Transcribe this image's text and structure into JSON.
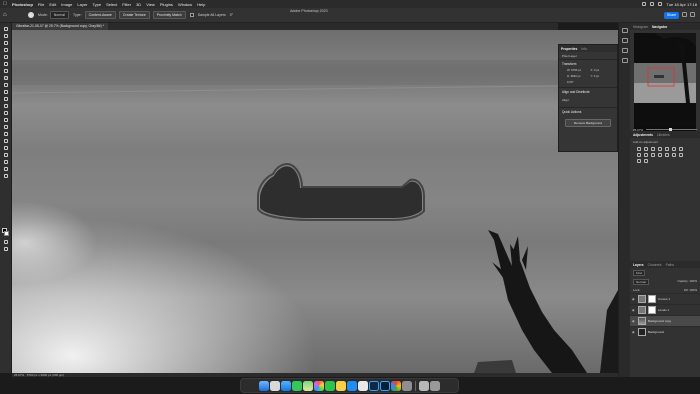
{
  "menubar": {
    "app": "Photoshop",
    "items": [
      "File",
      "Edit",
      "Image",
      "Layer",
      "Type",
      "Select",
      "Filter",
      "3D",
      "View",
      "Plugins",
      "Window",
      "Help"
    ],
    "datetime": "Tue 18 Apr  17:18"
  },
  "optionsbar": {
    "mode_label": "Mode:",
    "mode_value": "Normal",
    "type_label": "Type:",
    "content_aware": "Content-Aware",
    "create_texture": "Create Texture",
    "proximity_match": "Proximity Match",
    "sample_all": "Sample All Layers",
    "angle": "0°",
    "window_title": "Adobe Photoshop 2023",
    "share": "Share"
  },
  "document": {
    "tab_title": "Gibraltar-21-05-07 @ 25.7% (Background copy, Gray/8#) *"
  },
  "statusbar": {
    "zoom": "25.67%",
    "info": "5760 px x 3840 px (300 ppi)"
  },
  "properties": {
    "tab_active": "Properties",
    "tab_other": "Info",
    "layer_type": "Pixel Layer",
    "transform_title": "Transform",
    "w": "W: 5760 px",
    "x": "X: 0 px",
    "h": "H: 3840 px",
    "y": "Y: 0 px",
    "angle": "0.00°",
    "align_title": "Align and Distribute",
    "align_sub": "Align:",
    "quick_title": "Quick Actions",
    "remove_bg": "Remove Background"
  },
  "navigator": {
    "tab_histogram": "Histogram",
    "tab_navigator": "Navigator",
    "zoom": "25.67%"
  },
  "adjustments": {
    "tab_adjustments": "Adjustments",
    "tab_libraries": "Libraries",
    "subtitle": "Add an adjustment"
  },
  "layers": {
    "tab_layers": "Layers",
    "tab_channels": "Channels",
    "tab_paths": "Paths",
    "kind": "Kind",
    "blend": "Normal",
    "opacity": "Opacity: 100%",
    "lock": "Lock:",
    "fill": "Fill: 100%",
    "items": [
      {
        "name": "Curves 1",
        "selected": false
      },
      {
        "name": "Levels 1",
        "selected": false
      },
      {
        "name": "Background copy",
        "selected": true
      },
      {
        "name": "Background",
        "selected": false
      }
    ]
  },
  "dock": {
    "apps": [
      "Finder",
      "Launchpad",
      "Safari",
      "Messages",
      "Maps",
      "Photos",
      "FaceTime",
      "Notes",
      "App Store",
      "Preview",
      "Lightroom Classic",
      "Photoshop",
      "Chrome",
      "Settings",
      "Downloads",
      "Trash"
    ]
  },
  "colors": {
    "accent": "#1473e6",
    "panel": "#323232",
    "menubar": "#2b2b2b"
  }
}
